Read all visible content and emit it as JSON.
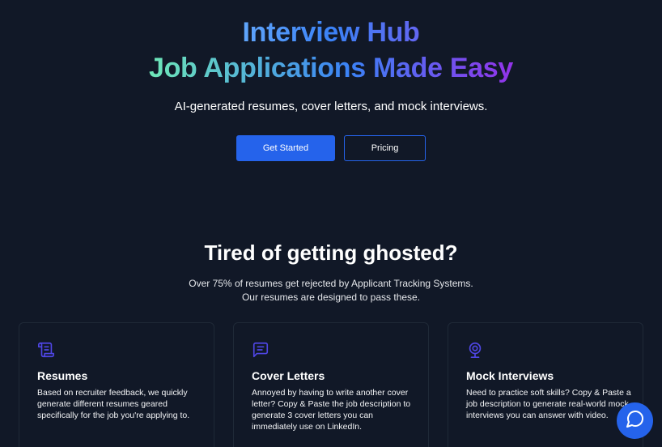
{
  "hero": {
    "title_line1": "Interview Hub",
    "title_line2": "Job Applications Made Easy",
    "subtitle": "AI-generated resumes, cover letters, and mock interviews.",
    "primary_button": "Get Started",
    "secondary_button": "Pricing"
  },
  "section": {
    "title": "Tired of getting ghosted?",
    "desc_line1": "Over 75% of resumes get rejected by Applicant Tracking Systems.",
    "desc_line2": "Our resumes are designed to pass these."
  },
  "features": [
    {
      "icon": "scroll-icon",
      "title": "Resumes",
      "text": "Based on recruiter feedback, we quickly generate different resumes geared specifically for the job you're applying to."
    },
    {
      "icon": "chat-bubble-icon",
      "title": "Cover Letters",
      "text": "Annoyed by having to write another cover letter? Copy & Paste the job description to generate 3 cover letters you can immediately use on LinkedIn."
    },
    {
      "icon": "webcam-icon",
      "title": "Mock Interviews",
      "text": "Need to practice soft skills? Copy & Paste a job description to generate real-world mock interviews you can answer with video."
    }
  ],
  "chat_widget": {
    "icon": "chat-icon"
  },
  "colors": {
    "background": "#111827",
    "accent": "#2563eb",
    "icon": "#4f46e5",
    "card_border": "#1f2937"
  }
}
